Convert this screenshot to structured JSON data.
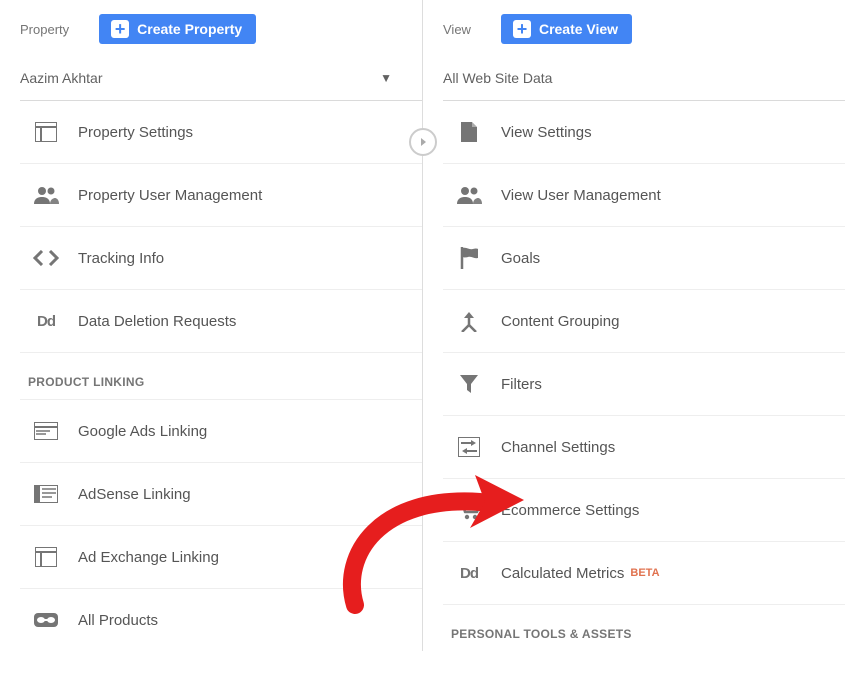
{
  "property": {
    "header_label": "Property",
    "create_label": "Create Property",
    "selector": "Aazim Akhtar",
    "items": [
      {
        "label": "Property Settings"
      },
      {
        "label": "Property User Management"
      },
      {
        "label": "Tracking Info"
      },
      {
        "label": "Data Deletion Requests"
      }
    ],
    "product_linking_label": "PRODUCT LINKING",
    "product_linking_items": [
      {
        "label": "Google Ads Linking"
      },
      {
        "label": "AdSense Linking"
      },
      {
        "label": "Ad Exchange Linking"
      },
      {
        "label": "All Products"
      }
    ]
  },
  "view": {
    "header_label": "View",
    "create_label": "Create View",
    "selector": "All Web Site Data",
    "items": [
      {
        "label": "View Settings"
      },
      {
        "label": "View User Management"
      },
      {
        "label": "Goals"
      },
      {
        "label": "Content Grouping"
      },
      {
        "label": "Filters"
      },
      {
        "label": "Channel Settings"
      },
      {
        "label": "Ecommerce Settings"
      },
      {
        "label": "Calculated Metrics",
        "badge": "BETA"
      }
    ],
    "personal_tools_label": "PERSONAL TOOLS & ASSETS"
  }
}
